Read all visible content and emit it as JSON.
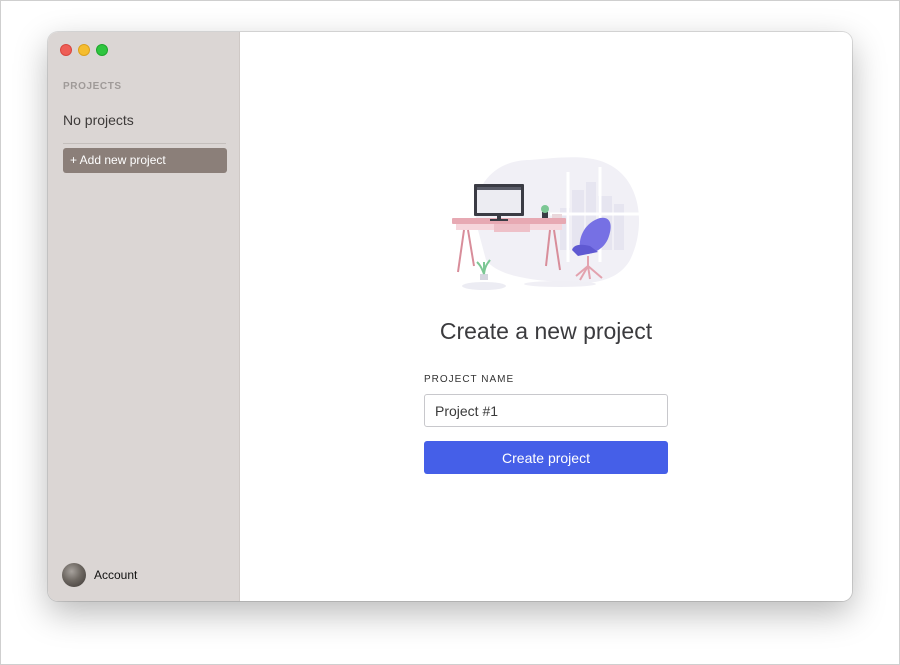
{
  "sidebar": {
    "section_label": "PROJECTS",
    "empty_text": "No projects",
    "add_button_label": "+ Add new project",
    "account_label": "Account"
  },
  "main": {
    "heading": "Create a new project",
    "field_label": "PROJECT NAME",
    "field_value": "Project #1",
    "submit_label": "Create project"
  },
  "colors": {
    "sidebar_bg": "#dbd6d4",
    "add_button_bg": "#8b7f79",
    "primary": "#455fe8",
    "traffic_red": "#ee5e56",
    "traffic_yellow": "#f5bd2f",
    "traffic_green": "#2fc53f"
  },
  "icons": {
    "illustration": "desk-workspace-illustration",
    "avatar": "account-avatar"
  }
}
